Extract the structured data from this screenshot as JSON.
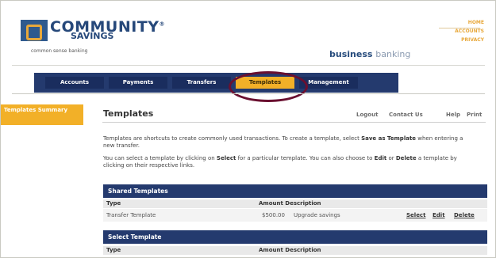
{
  "brand": {
    "name_line1": "COMMUNITY",
    "trademark": "®",
    "name_line2": "SAVINGS",
    "tagline": "common sense banking",
    "section": "business",
    "section_suffix": "banking"
  },
  "top_links": [
    "HOME",
    "ACCOUNTS",
    "PRIVACY"
  ],
  "nav": {
    "tabs": [
      {
        "label": "Accounts"
      },
      {
        "label": "Payments"
      },
      {
        "label": "Transfers"
      },
      {
        "label": "Templates",
        "active": true
      },
      {
        "label": "Management"
      }
    ]
  },
  "sidebar": {
    "items": [
      {
        "label": "Templates Summary",
        "active": true
      }
    ]
  },
  "main": {
    "title": "Templates",
    "utility_links": [
      "Logout",
      "Contact Us",
      "Help",
      "Print"
    ],
    "intro_1a": "Templates are shortcuts to create commonly used transactions. To create a template, select ",
    "intro_1b": "Save as Template",
    "intro_1c": " when entering a new transfer.",
    "intro_2a": "You can select a template by clicking on ",
    "intro_2b": "Select",
    "intro_2c": " for a particular template. You can also choose to ",
    "intro_2d": "Edit",
    "intro_2e": " or ",
    "intro_2f": "Delete",
    "intro_2g": " a template by clicking on their respective links.",
    "shared": {
      "heading": "Shared Templates",
      "col_type": "Type",
      "col_amount_desc": "Amount Description",
      "rows": [
        {
          "type": "Transfer Template",
          "amount": "$500.00",
          "description": "Upgrade savings",
          "select": "Select",
          "edit": "Edit",
          "delete": "Delete"
        }
      ]
    },
    "select": {
      "heading": "Select Template",
      "col_type": "Type",
      "col_amount_desc": "Amount Description"
    }
  },
  "colors": {
    "navy": "#243a6e",
    "accent": "#f2b028",
    "highlight_ring": "#6a1030"
  }
}
